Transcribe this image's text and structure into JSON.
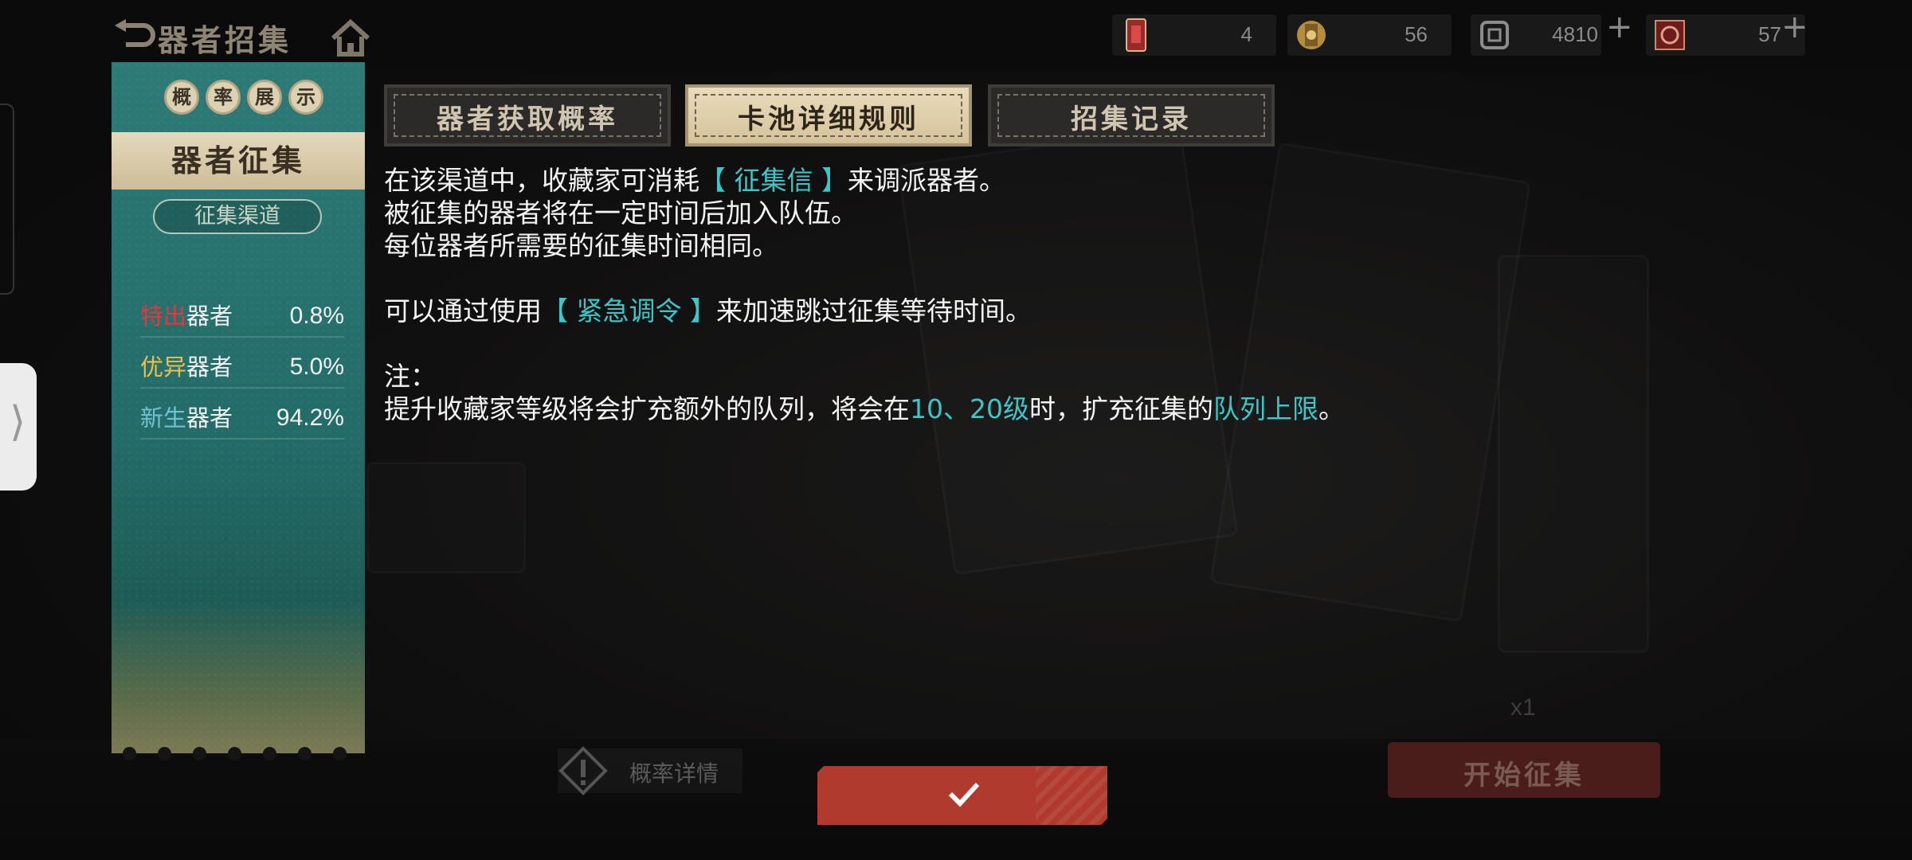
{
  "header": {
    "title": "器者招集",
    "resources": [
      {
        "icon": "ticket-icon",
        "value": "4"
      },
      {
        "icon": "gold-coin-icon",
        "value": "56"
      },
      {
        "icon": "scroll-icon",
        "value": "4810"
      },
      {
        "icon": "seal-icon",
        "value": "57"
      }
    ]
  },
  "panel": {
    "header_chars": [
      "概",
      "率",
      "展",
      "示"
    ],
    "banner": "器者征集",
    "channel": "征集渠道",
    "rates": [
      {
        "quality": "特出",
        "suffix": "器者",
        "pct": "0.8%",
        "color": "#e0393e"
      },
      {
        "quality": "优异",
        "suffix": "器者",
        "pct": "5.0%",
        "color": "#e8c14d"
      },
      {
        "quality": "新生",
        "suffix": "器者",
        "pct": "94.2%",
        "color": "#6fc2cf"
      }
    ]
  },
  "tabs": [
    {
      "label": "器者获取概率",
      "active": false
    },
    {
      "label": "卡池详细规则",
      "active": true
    },
    {
      "label": "招集记录",
      "active": false
    }
  ],
  "rules": {
    "l1_pre": "在该渠道中，收藏家可消耗",
    "l1_hl": "【 征集信 】",
    "l1_post": "来调派器者。",
    "l2": "被征集的器者将在一定时间后加入队伍。",
    "l3": "每位器者所需要的征集时间相同。",
    "l4_pre": "可以通过使用",
    "l4_hl": "【 紧急调令 】",
    "l4_post": "来加速跳过征集等待时间。",
    "l5": "注：",
    "l6_pre": "提升收藏家等级将会扩充额外的队列，将会在",
    "l6_hl1": "10、20级",
    "l6_mid": "时，扩充征集的",
    "l6_hl2": "队列上限",
    "l6_post": "。"
  },
  "bottom": {
    "detail_label": "概率详情",
    "start_label": "开始征集",
    "counter": "x1"
  },
  "colors": {
    "accent_cyan": "#3ec5c8",
    "confirm_red": "#b03a2e",
    "panel_teal": "#2d7a77"
  }
}
